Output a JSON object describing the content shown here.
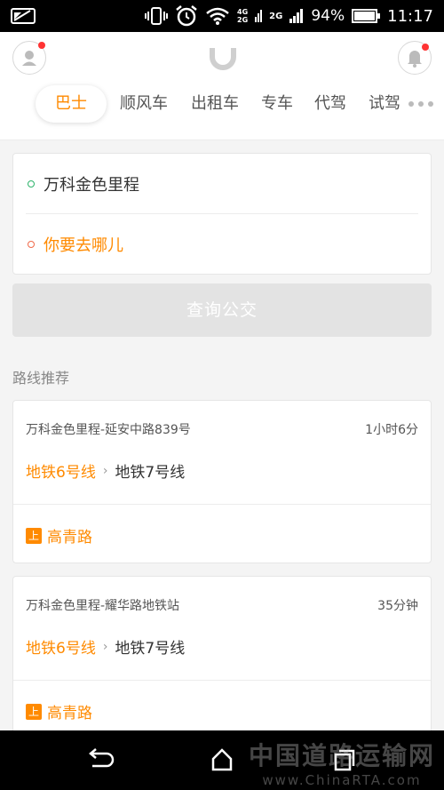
{
  "status_bar": {
    "network_top": "4G",
    "network_bottom": "2G",
    "network2": "2G",
    "battery": "94%",
    "time": "11:17"
  },
  "header": {
    "tabs": [
      {
        "label": "巴士",
        "active": true
      },
      {
        "label": "顺风车",
        "active": false
      },
      {
        "label": "出租车",
        "active": false
      },
      {
        "label": "专车",
        "active": false
      },
      {
        "label": "代驾",
        "active": false
      },
      {
        "label": "试驾",
        "active": false
      }
    ]
  },
  "address": {
    "from": "万科金色里程",
    "to_placeholder": "你要去哪儿",
    "from_dot_color": "#2db36b",
    "to_dot_color": "#f06a4a"
  },
  "query_button": "查询公交",
  "section_title": "路线推荐",
  "routes": [
    {
      "name": "万科金色里程-延安中路839号",
      "duration": "1小时6分",
      "line1": "地铁6号线",
      "line2": "地铁7号线",
      "badge": "上",
      "stop": "高青路"
    },
    {
      "name": "万科金色里程-耀华路地铁站",
      "duration": "35分钟",
      "line1": "地铁6号线",
      "line2": "地铁7号线",
      "badge": "上",
      "stop": "高青路"
    }
  ],
  "watermark": {
    "cn": "中国道路运输网",
    "en": "www.ChinaRTA.com"
  },
  "colors": {
    "accent": "#ff8a00"
  }
}
